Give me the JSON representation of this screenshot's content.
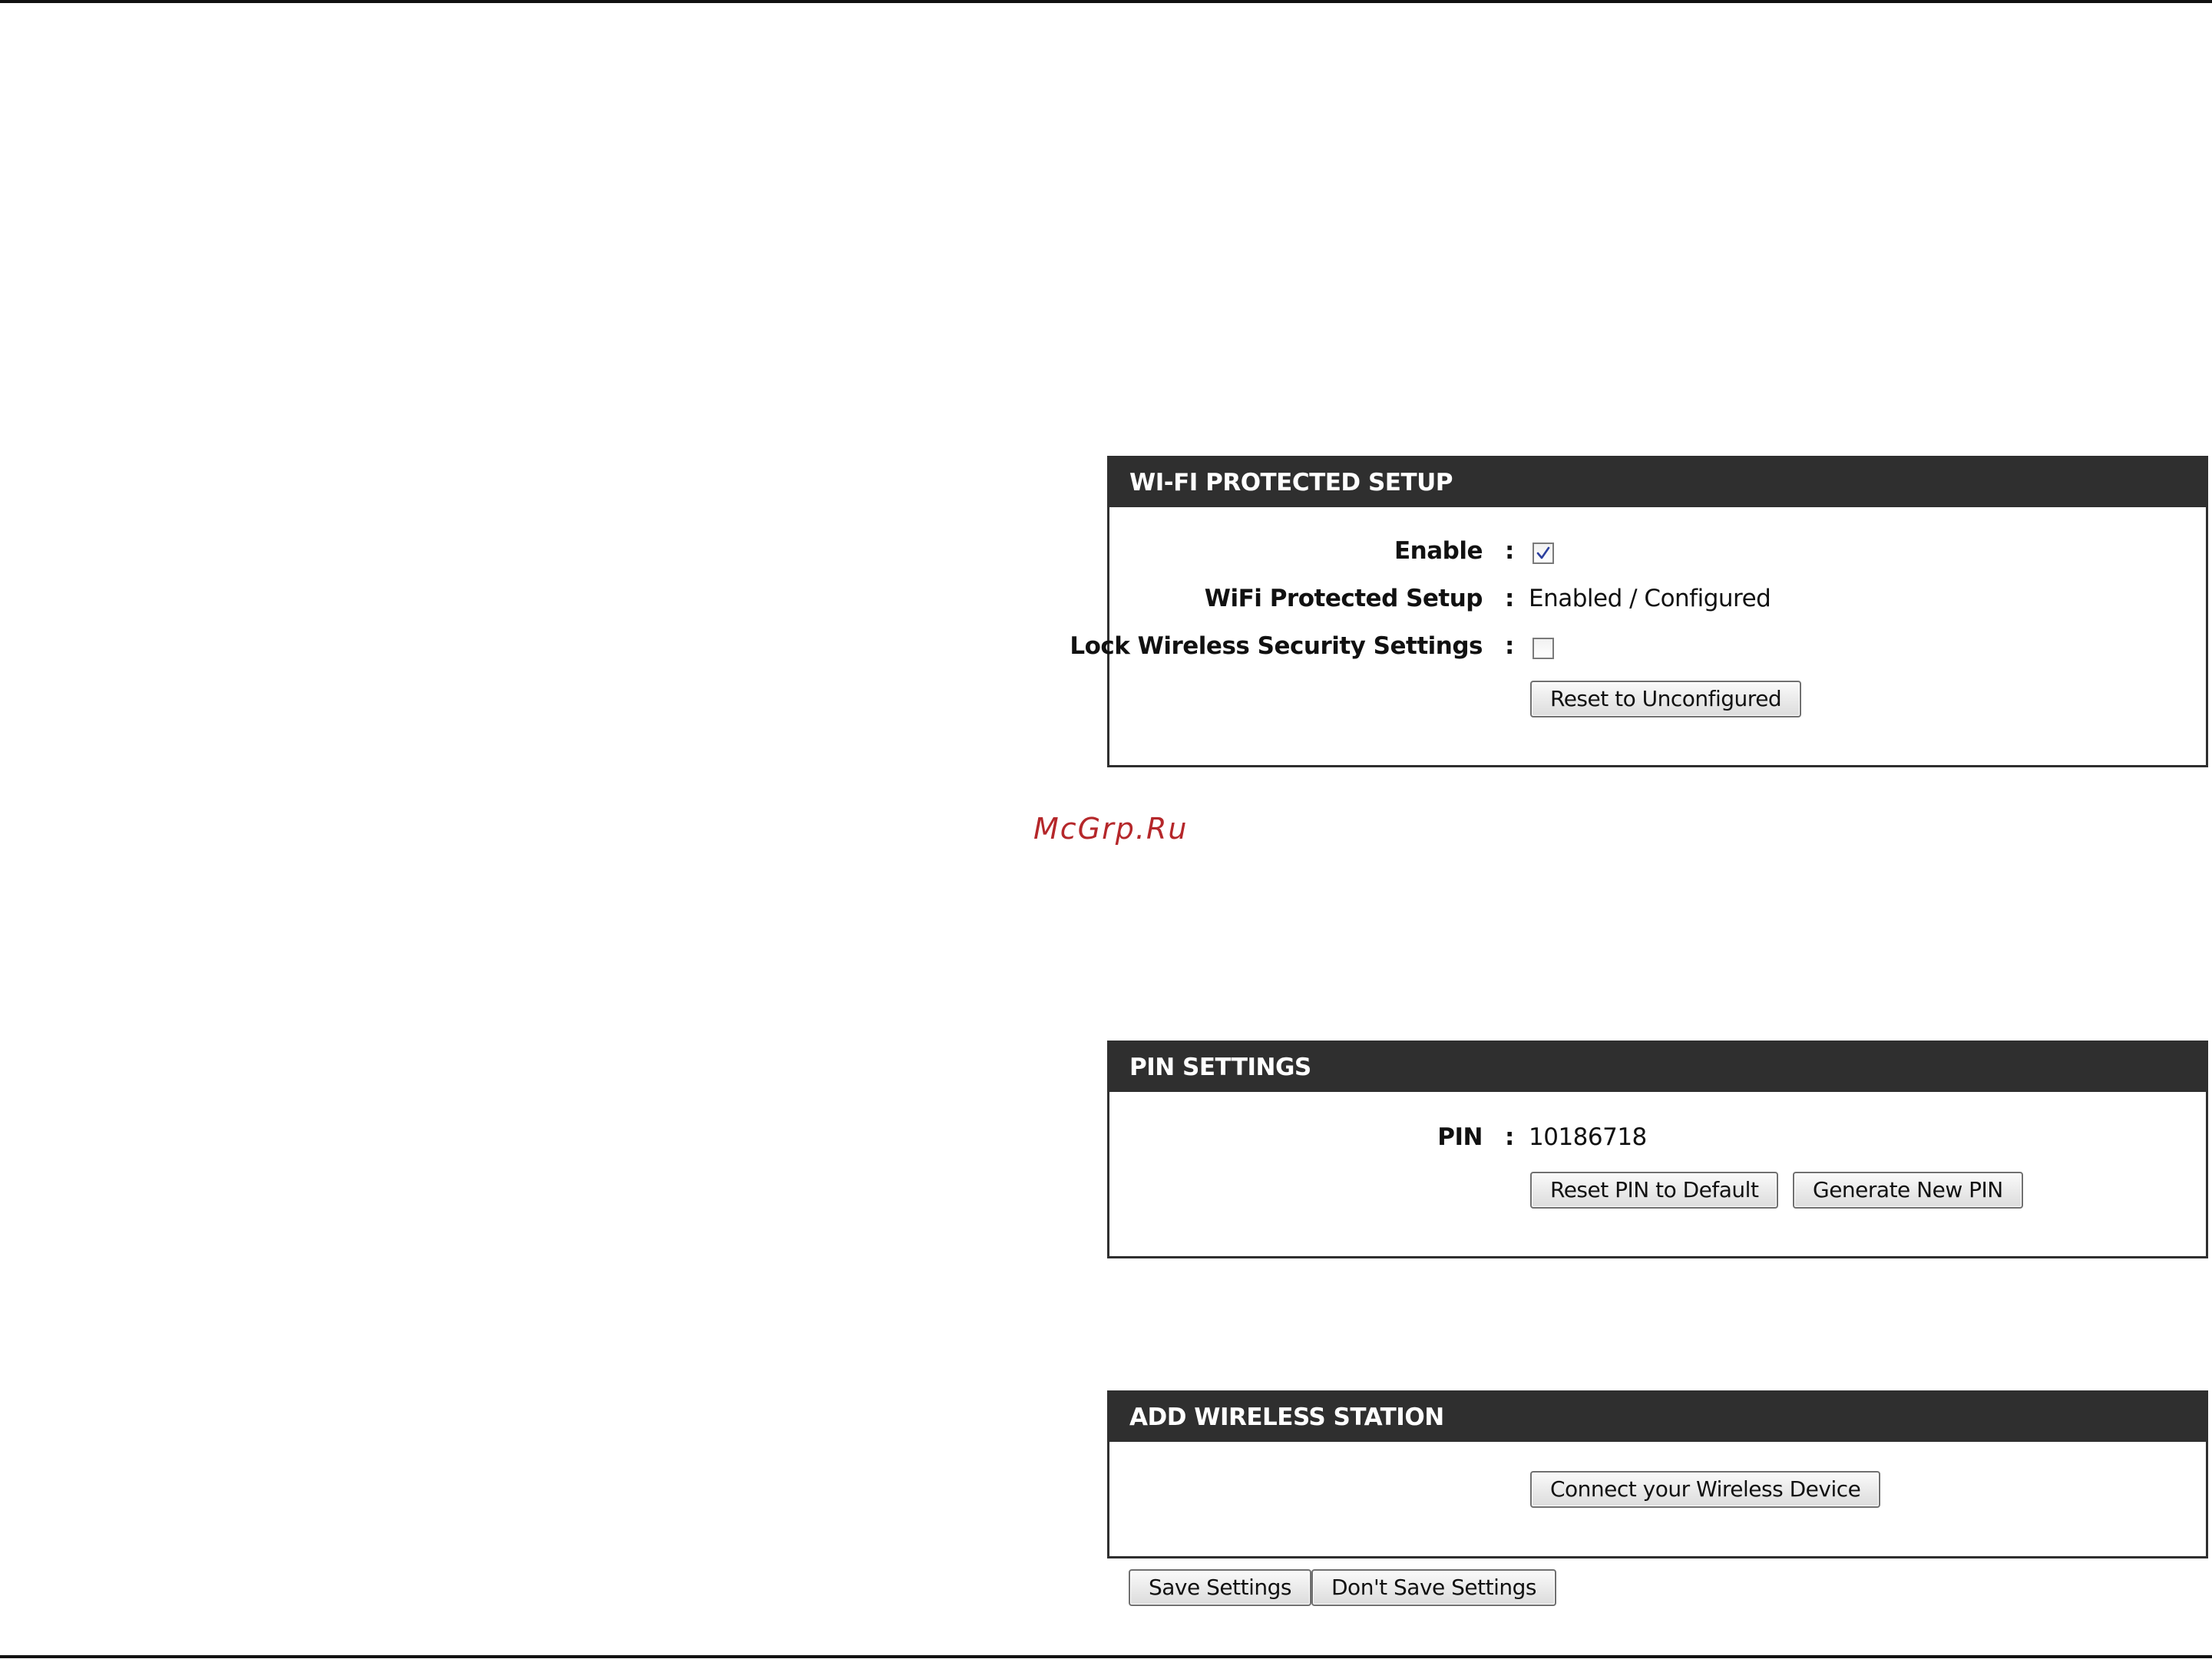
{
  "watermark": "McGrp.Ru",
  "wps": {
    "title": "WI-FI PROTECTED SETUP",
    "enable_label": "Enable",
    "enable_checked": true,
    "wps_status_label": "WiFi Protected Setup",
    "wps_status_value": "Enabled / Configured",
    "lock_label": "Lock Wireless Security Settings",
    "lock_checked": false,
    "reset_unconfigured_label": "Reset to Unconfigured",
    "colon": ":"
  },
  "pin": {
    "title": "PIN SETTINGS",
    "pin_label": "PIN",
    "pin_value": "10186718",
    "reset_pin_label": "Reset PIN to Default",
    "generate_pin_label": "Generate New PIN",
    "colon": ":"
  },
  "station": {
    "title": "ADD WIRELESS STATION",
    "connect_label": "Connect your Wireless Device"
  },
  "footer": {
    "save_label": "Save Settings",
    "dont_save_label": "Don't Save Settings"
  },
  "colors": {
    "header_bg": "#2f2f2f",
    "watermark": "#b5272a",
    "check": "#2b3f9e"
  }
}
